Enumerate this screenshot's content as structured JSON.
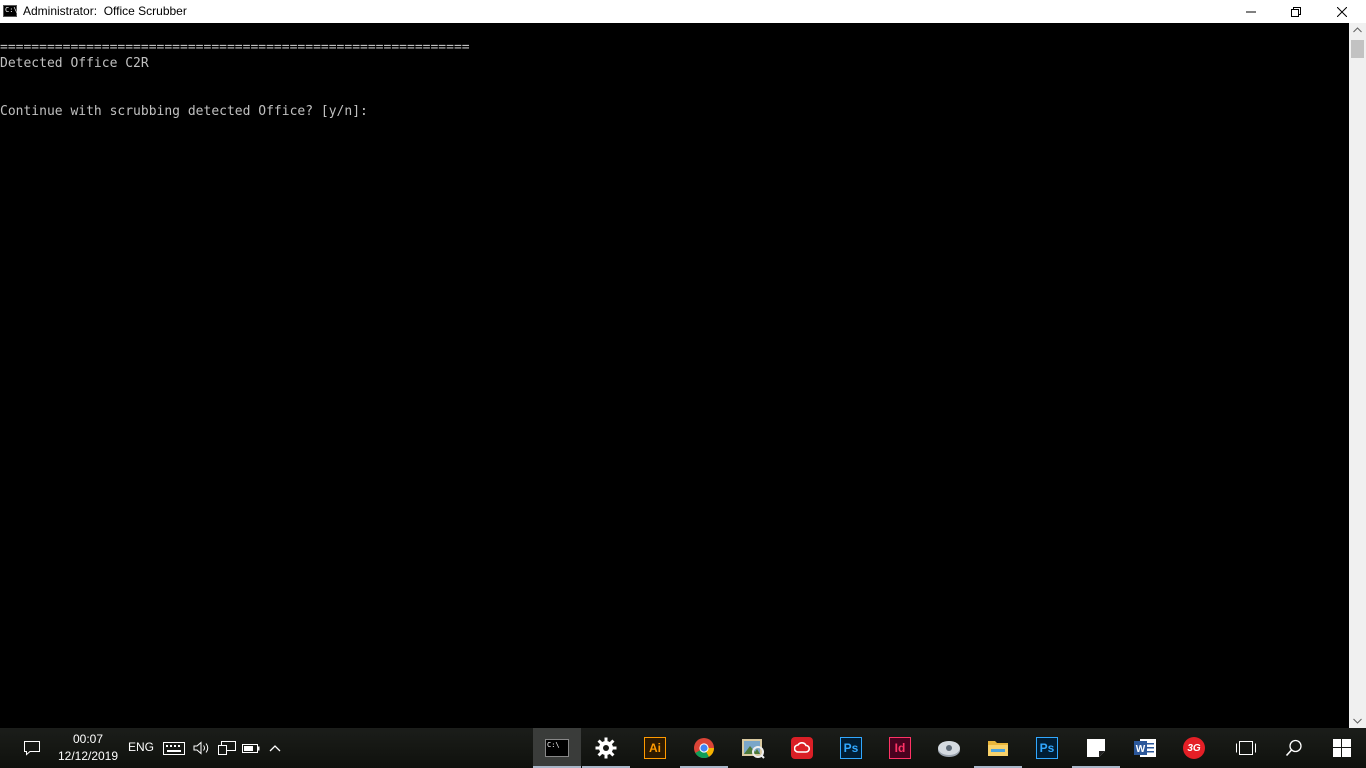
{
  "window": {
    "title": "Administrator:  Office Scrubber",
    "icon_text": "C:\\"
  },
  "console": {
    "lines": [
      "============================================================",
      "Detected Office C2R",
      "",
      "Continue with scrubbing detected Office? [y/n]:"
    ]
  },
  "taskbar": {
    "clock_time": "00:07",
    "clock_date": "12/12/2019",
    "language": "ENG",
    "apps": [
      {
        "name": "command-prompt",
        "label": "C:\\"
      },
      {
        "name": "settings",
        "label": ""
      },
      {
        "name": "illustrator",
        "label": "Ai"
      },
      {
        "name": "chrome",
        "label": ""
      },
      {
        "name": "photos",
        "label": ""
      },
      {
        "name": "creative-cloud",
        "label": ""
      },
      {
        "name": "photoshop",
        "label": "Ps"
      },
      {
        "name": "indesign",
        "label": "Id"
      },
      {
        "name": "utility",
        "label": ""
      },
      {
        "name": "file-explorer",
        "label": ""
      },
      {
        "name": "photoshop-2",
        "label": "Ps"
      },
      {
        "name": "sticky-notes",
        "label": ""
      },
      {
        "name": "word",
        "label": "W"
      },
      {
        "name": "app-3g",
        "label": "3G"
      }
    ]
  },
  "colors": {
    "console_bg": "#000000",
    "console_text": "#c0c0c0",
    "taskbar_bg": "#161814",
    "accent_ai": "#ff9a00",
    "accent_ps": "#31a8ff",
    "accent_id": "#ff3366",
    "accent_word": "#2b579a"
  }
}
